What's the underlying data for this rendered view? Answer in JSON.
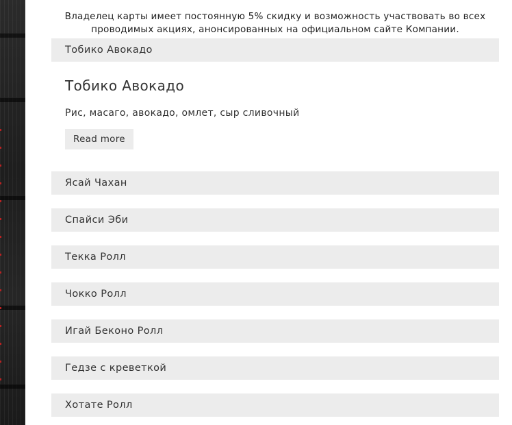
{
  "intro_text": "Владелец карты имеет постоянную 5% скидку и возможность участвовать во всех проводимых акциях, анонсированных на официальном сайте Компании.",
  "accordion": {
    "open_item": {
      "header": "Тобико Авокадо",
      "title": "Тобико Авокадо",
      "description": "Рис, масаго, авокадо, омлет, сыр сливочный",
      "read_more_label": "Read more"
    },
    "items": [
      {
        "header": "Ясай Чахан"
      },
      {
        "header": "Спайси Эби"
      },
      {
        "header": "Текка Ролл"
      },
      {
        "header": "Чокко Ролл"
      },
      {
        "header": "Игай Беконо Ролл"
      },
      {
        "header": "Гедзе с креветкой"
      },
      {
        "header": "Хотате Ролл"
      }
    ]
  },
  "colors": {
    "header_bg": "#ececec",
    "side_strip": "#222222"
  }
}
